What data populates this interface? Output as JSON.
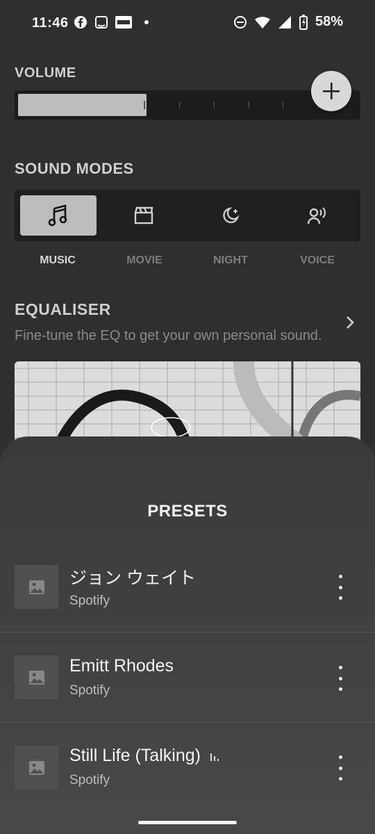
{
  "status_bar": {
    "time": "11:46",
    "battery": "58%"
  },
  "volume": {
    "title": "VOLUME",
    "level": 0.38
  },
  "sound_modes": {
    "title": "SOUND MODES",
    "modes": [
      {
        "label": "MUSIC",
        "icon": "music-note-icon",
        "active": true
      },
      {
        "label": "MOVIE",
        "icon": "clapperboard-icon",
        "active": false
      },
      {
        "label": "NIGHT",
        "icon": "moon-stars-icon",
        "active": false
      },
      {
        "label": "VOICE",
        "icon": "person-speaking-icon",
        "active": false
      }
    ]
  },
  "equaliser": {
    "title": "EQUALISER",
    "subtitle": "Fine-tune the EQ to get your own personal sound."
  },
  "presets": {
    "title": "PRESETS",
    "items": [
      {
        "title": "ジョン ウェイト",
        "source": "Spotify"
      },
      {
        "title": "Emitt Rhodes",
        "source": "Spotify"
      },
      {
        "title": "Still Life (Talking)",
        "source": "Spotify"
      }
    ]
  }
}
